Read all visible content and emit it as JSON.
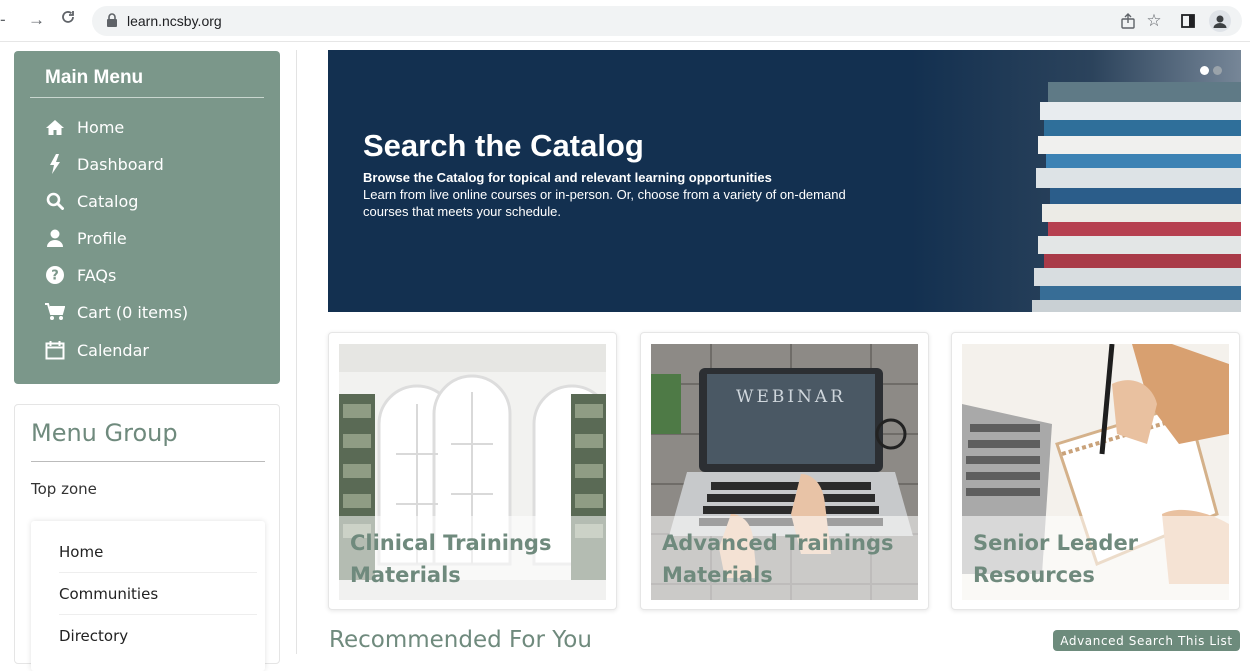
{
  "browser": {
    "url": "learn.ncsby.org"
  },
  "sidebar": {
    "main_menu_title": "Main Menu",
    "items": [
      {
        "label": "Home",
        "icon": "home-icon"
      },
      {
        "label": "Dashboard",
        "icon": "bolt-icon"
      },
      {
        "label": "Catalog",
        "icon": "search-icon"
      },
      {
        "label": "Profile",
        "icon": "user-icon"
      },
      {
        "label": "FAQs",
        "icon": "question-icon"
      },
      {
        "label": "Cart (0 items)",
        "icon": "cart-icon"
      },
      {
        "label": "Calendar",
        "icon": "calendar-icon"
      }
    ],
    "menu_group": {
      "title": "Menu Group",
      "zone_label": "Top zone",
      "items": [
        "Home",
        "Communities",
        "Directory"
      ]
    }
  },
  "hero": {
    "title": "Search the Catalog",
    "subtitle": "Browse the Catalog for topical and relevant learning opportunities",
    "description": "Learn from live online courses or in-person. Or, choose from a variety of on-demand courses that meets your schedule.",
    "slide_count": 2,
    "active_slide": 1
  },
  "cards": [
    {
      "label": "Clinical Trainings Materials"
    },
    {
      "label": "Advanced Trainings Materials"
    },
    {
      "label": "Senior Leader Resources"
    }
  ],
  "recommended": {
    "title": "Recommended For You",
    "advanced_search_label": "Advanced Search This List"
  },
  "colors": {
    "sidebar_green": "#7b978a",
    "heading_green": "#6f8a7d",
    "hero_navy": "#133050",
    "button_green": "#6d8b7c"
  }
}
